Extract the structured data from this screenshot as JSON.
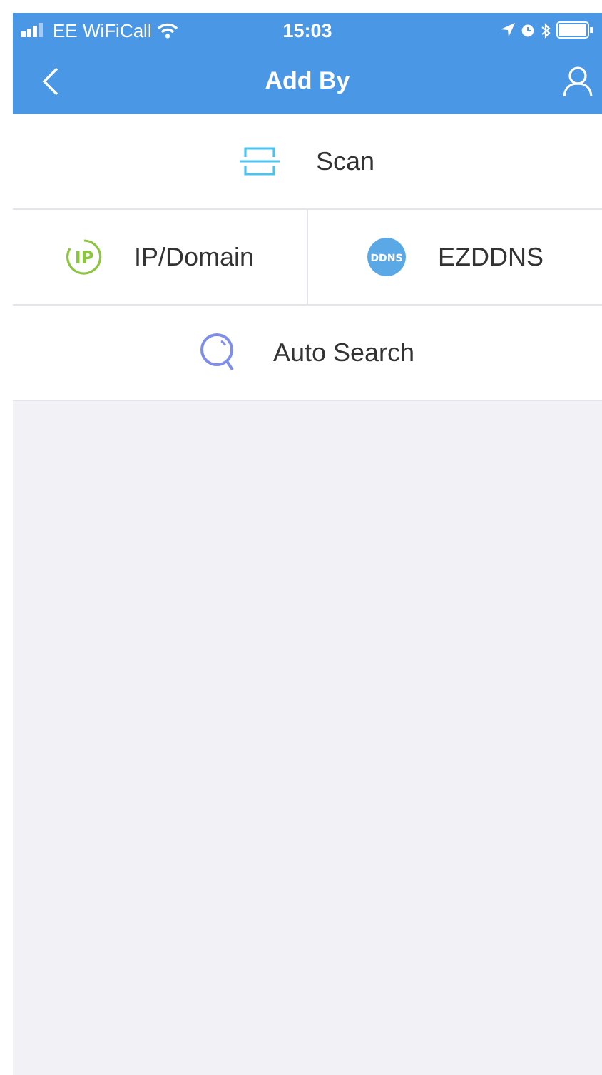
{
  "status_bar": {
    "carrier": "EE WiFiCall",
    "time": "15:03"
  },
  "nav": {
    "title": "Add By"
  },
  "options": [
    {
      "kind": "scan",
      "label": "Scan"
    },
    {
      "kind": "pair",
      "items": [
        {
          "kind": "ip",
          "label": "IP/Domain",
          "icon_text": "IP"
        },
        {
          "kind": "ddns",
          "label": "EZDDNS",
          "icon_text": "DDNS"
        }
      ]
    },
    {
      "kind": "search",
      "label": "Auto Search"
    }
  ]
}
